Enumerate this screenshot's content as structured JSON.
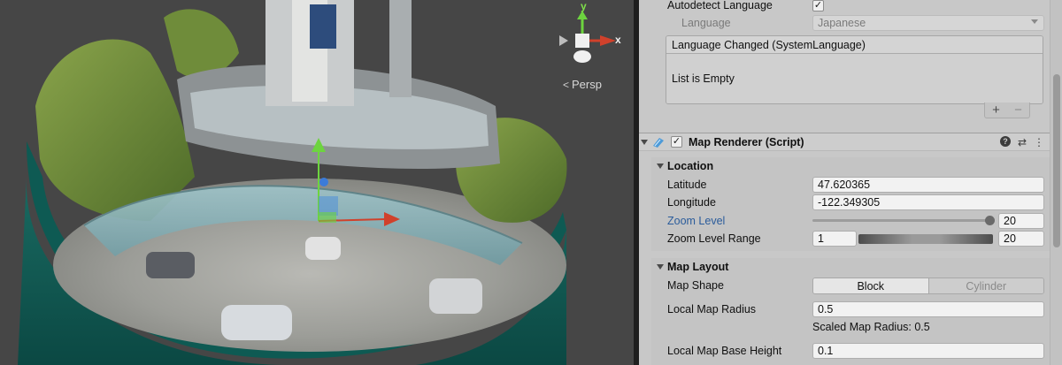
{
  "scene": {
    "gizmo": {
      "y_label": "y",
      "x_label": "x"
    },
    "view_mode": "Persp"
  },
  "inspector": {
    "autodetect_language": {
      "label": "Autodetect Language",
      "checked": true,
      "check_glyph": "✓"
    },
    "language": {
      "label": "Language",
      "value": "Japanese"
    },
    "language_changed_event": {
      "title": "Language Changed (SystemLanguage)",
      "empty_text": "List is Empty",
      "add_label": "+",
      "remove_label": "−"
    },
    "map_renderer": {
      "title": "Map Renderer (Script)",
      "enabled": true,
      "check_glyph": "✓",
      "icons": [
        "help-icon",
        "presets-icon",
        "kebab-menu-icon"
      ],
      "icon_glyphs": {
        "help": "?",
        "presets": "⇄",
        "menu": "⋮"
      }
    },
    "location": {
      "header": "Location",
      "latitude": {
        "label": "Latitude",
        "value": "47.620365"
      },
      "longitude": {
        "label": "Longitude",
        "value": "-122.349305"
      },
      "zoom_level": {
        "label": "Zoom Level",
        "value": "20",
        "fraction": 1.0
      },
      "zoom_level_range": {
        "label": "Zoom Level Range",
        "min": "1",
        "max": "20"
      }
    },
    "map_layout": {
      "header": "Map Layout",
      "map_shape": {
        "label": "Map Shape",
        "options": [
          "Block",
          "Cylinder"
        ],
        "selected": "Block"
      },
      "local_map_radius": {
        "label": "Local Map Radius",
        "value": "0.5"
      },
      "scaled_map_radius": "Scaled Map Radius: 0.5",
      "local_map_base_height": {
        "label": "Local Map Base Height",
        "value": "0.1"
      }
    }
  },
  "colors": {
    "scene_background": "#464646",
    "inspector_background": "#c8c8c8",
    "cylinder_teal": "#0f5c55",
    "link_blue": "#2b5c9b",
    "axis_x": "#d0412b",
    "axis_y": "#6dd43f",
    "axis_z": "#3b7bd8"
  }
}
